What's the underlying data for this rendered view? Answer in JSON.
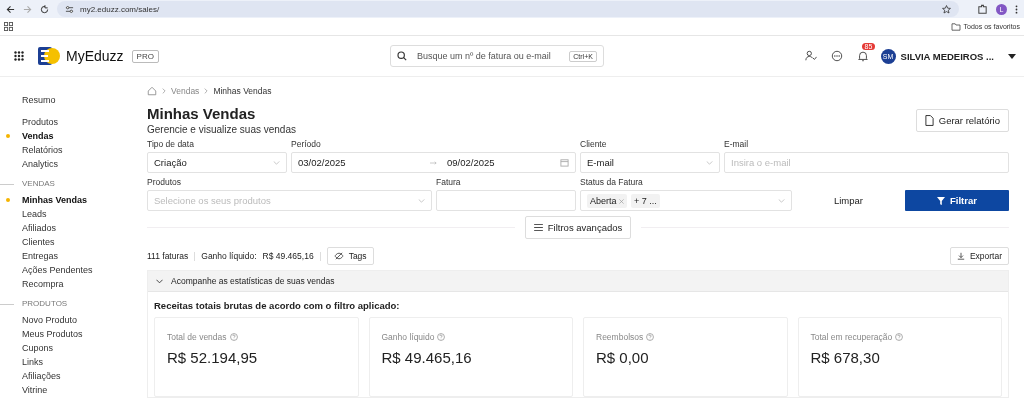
{
  "browser": {
    "url": "my2.eduzz.com/sales/",
    "profile_initial": "L",
    "bookmarks_label": "Todos os favoritos"
  },
  "header": {
    "app_name": "MyEduzz",
    "plan_badge": "PRO",
    "search": {
      "placeholder": "Busque um nº de fatura ou e-mail",
      "shortcut": "Ctrl+K"
    },
    "notifications_count": "85",
    "user": {
      "initials": "SM",
      "name": "SILVIA MEDEIROS ..."
    }
  },
  "sidebar": {
    "groups": [
      {
        "items": [
          {
            "label": "Resumo",
            "selected": false
          }
        ]
      },
      {
        "items": [
          {
            "label": "Produtos",
            "selected": false
          },
          {
            "label": "Vendas",
            "selected": true
          },
          {
            "label": "Relatórios",
            "selected": false
          },
          {
            "label": "Analytics",
            "selected": false
          }
        ]
      },
      {
        "title": "VENDAS",
        "items": [
          {
            "label": "Minhas Vendas",
            "selected": true
          },
          {
            "label": "Leads",
            "selected": false
          },
          {
            "label": "Afiliados",
            "selected": false
          },
          {
            "label": "Clientes",
            "selected": false
          },
          {
            "label": "Entregas",
            "selected": false
          },
          {
            "label": "Ações Pendentes",
            "selected": false
          },
          {
            "label": "Recompra",
            "selected": false
          }
        ]
      },
      {
        "title": "PRODUTOS",
        "items": [
          {
            "label": "Novo Produto",
            "selected": false
          },
          {
            "label": "Meus Produtos",
            "selected": false
          },
          {
            "label": "Cupons",
            "selected": false
          },
          {
            "label": "Links",
            "selected": false
          },
          {
            "label": "Afiliações",
            "selected": false
          },
          {
            "label": "Vitrine",
            "selected": false
          }
        ]
      }
    ]
  },
  "breadcrumb": [
    "Vendas",
    "Minhas Vendas"
  ],
  "page": {
    "title": "Minhas Vendas",
    "subtitle": "Gerencie e visualize suas vendas",
    "report_button": "Gerar relatório"
  },
  "filters": {
    "rows": [
      [
        {
          "kind": "select",
          "label": "Tipo de data",
          "value": "Criação"
        },
        {
          "kind": "daterange",
          "label": "Período",
          "start": "03/02/2025",
          "end": "09/02/2025"
        },
        {
          "kind": "select",
          "label": "Cliente",
          "value": "E-mail"
        },
        {
          "kind": "input",
          "label": "E-mail",
          "placeholder": "Insira o e-mail"
        }
      ],
      [
        {
          "kind": "select",
          "label": "Produtos",
          "placeholder": "Selecione os seus produtos"
        },
        {
          "kind": "input",
          "label": "Fatura"
        },
        {
          "kind": "tags",
          "label": "Status da Fatura",
          "tags": [
            "Aberta"
          ],
          "more": "+ 7 ..."
        }
      ]
    ],
    "clear_button": "Limpar",
    "filter_button": "Filtrar",
    "advanced_button": "Filtros avançados"
  },
  "summary": {
    "count": "111 faturas",
    "net_label": "Ganho líquido:",
    "net_value": "R$ 49.465,16",
    "tags_button": "Tags",
    "export_button": "Exportar"
  },
  "stats": {
    "header": "Acompanhe as estatísticas de suas vendas",
    "expanded": true,
    "title": "Receitas totais brutas de acordo com o filtro aplicado:",
    "cards": [
      {
        "label": "Total de vendas",
        "value": "R$ 52.194,95"
      },
      {
        "label": "Ganho líquido",
        "value": "R$ 49.465,16"
      },
      {
        "label": "Reembolsos",
        "value": "R$ 0,00"
      },
      {
        "label": "Total em recuperação",
        "value": "R$ 678,30"
      }
    ]
  }
}
